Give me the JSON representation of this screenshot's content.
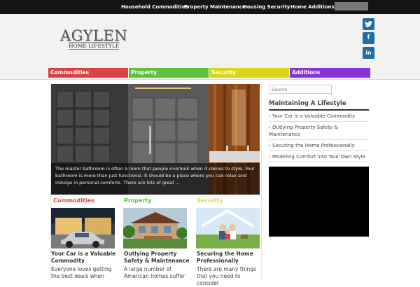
{
  "top_nav": {
    "items": [
      "Household Commodities",
      "Property Maintenance",
      "Housing Security",
      "Home Additions"
    ]
  },
  "logo": {
    "main": "AGYLEN",
    "sub": "HOME LIFESTYLE"
  },
  "social": {
    "twitter": "twitter-icon",
    "facebook": "facebook-icon",
    "linkedin": "linkedin-icon"
  },
  "main_nav": {
    "items": [
      {
        "label": "Commodities",
        "color": "#d94343",
        "text": "#ffffff"
      },
      {
        "label": "Property",
        "color": "#5cc23d",
        "text": "#ffffff"
      },
      {
        "label": "Security",
        "color": "#d9d614",
        "text": "#ffffff"
      },
      {
        "label": "Additions",
        "color": "#8a34d6",
        "text": "#ffffff"
      }
    ]
  },
  "hero": {
    "caption": "The master bathroom is often a room that people overlook when it comes to style. Your bathroom is more than just functional. It should be a place where you can relax and indulge in personal comforts. There are lots of great ..."
  },
  "cards": [
    {
      "category": "Commodities",
      "category_color": "#d94343",
      "title": "Your Car is a Valuable Commodity",
      "excerpt": "Everyone loves getting the best deals when"
    },
    {
      "category": "Property",
      "category_color": "#5cc23d",
      "title": "Outlying Property Safety & Maintenance",
      "excerpt": "A large number of American homes suffer"
    },
    {
      "category": "Security",
      "category_color": "#e0d820",
      "title": "Securing the Home Professionally",
      "excerpt": "There are many things that you need to consider"
    }
  ],
  "sidebar": {
    "search_placeholder": "Search",
    "heading": "Maintaining A Lifestyle",
    "links": [
      "› Your Car is a Valuable Commodity",
      "› Outlying Property Safety & Maintenance",
      "› Securing the Home Professionally",
      "› Modeling Comfort into Your Own Style"
    ]
  }
}
